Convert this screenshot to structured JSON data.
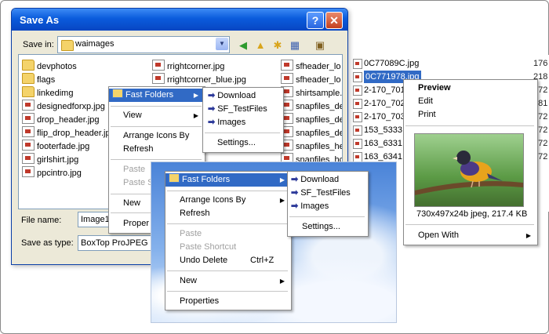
{
  "dialog": {
    "title": "Save As",
    "help_glyph": "?",
    "close_glyph": "✕",
    "save_in_label": "Save in:",
    "save_in_value": "waimages",
    "file_name_label": "File name:",
    "file_name_value": "Image1",
    "save_type_label": "Save as type:",
    "save_type_value": "BoxTop ProJPEG"
  },
  "files_col1": [
    "devphotos",
    "flags",
    "linkedimg",
    "designedforxp.jpg",
    "drop_header.jpg",
    "flip_drop_header.jpg",
    "footerfade.jpg",
    "girlshirt.jpg",
    "ppcintro.jpg"
  ],
  "files_col2": [
    "rrightcorner.jpg",
    "rrightcorner_blue.jpg"
  ],
  "files_col3": [
    "sfheader_lo",
    "sfheader_lo",
    "shirtsample.",
    "snapfiles_de",
    "snapfiles_de",
    "snapfiles_de",
    "snapfiles_he",
    "snapfiles_hc"
  ],
  "menu1": {
    "fast_folders": "Fast Folders",
    "view": "View",
    "arrange": "Arrange Icons By",
    "refresh": "Refresh",
    "paste": "Paste",
    "paste_short": "Paste S",
    "new": "New",
    "properties": "Proper"
  },
  "submenu1": {
    "download": "Download",
    "sf_testfiles": "SF_TestFiles",
    "images": "Images",
    "settings": "Settings..."
  },
  "menu2": {
    "fast_folders": "Fast Folders",
    "arrange": "Arrange Icons By",
    "refresh": "Refresh",
    "paste": "Paste",
    "paste_shortcut": "Paste Shortcut",
    "undo_delete": "Undo Delete",
    "undo_shortcut": "Ctrl+Z",
    "new": "New",
    "properties": "Properties"
  },
  "submenu2": {
    "download": "Download",
    "sf_testfiles": "SF_TestFiles",
    "images": "Images",
    "settings": "Settings..."
  },
  "right_list": [
    {
      "name": "0C77089C.jpg",
      "size": "176"
    },
    {
      "name": "0C771978.jpg",
      "size": "218"
    },
    {
      "name": "2-170_701",
      "size": "072"
    },
    {
      "name": "2-170_702",
      "size": "081"
    },
    {
      "name": "2-170_703",
      "size": "072"
    },
    {
      "name": "153_5333",
      "size": "072"
    },
    {
      "name": "163_6331",
      "size": "172"
    },
    {
      "name": "163_6341",
      "size": "172"
    }
  ],
  "context3": {
    "preview": "Preview",
    "edit": "Edit",
    "print": "Print",
    "image_info": "730x497x24b jpeg, 217.4 KB",
    "open_with": "Open With"
  },
  "colors": {
    "titlebar": "#0a5bdc",
    "highlight": "#316ac5",
    "dialog_bg": "#ece9d8"
  }
}
